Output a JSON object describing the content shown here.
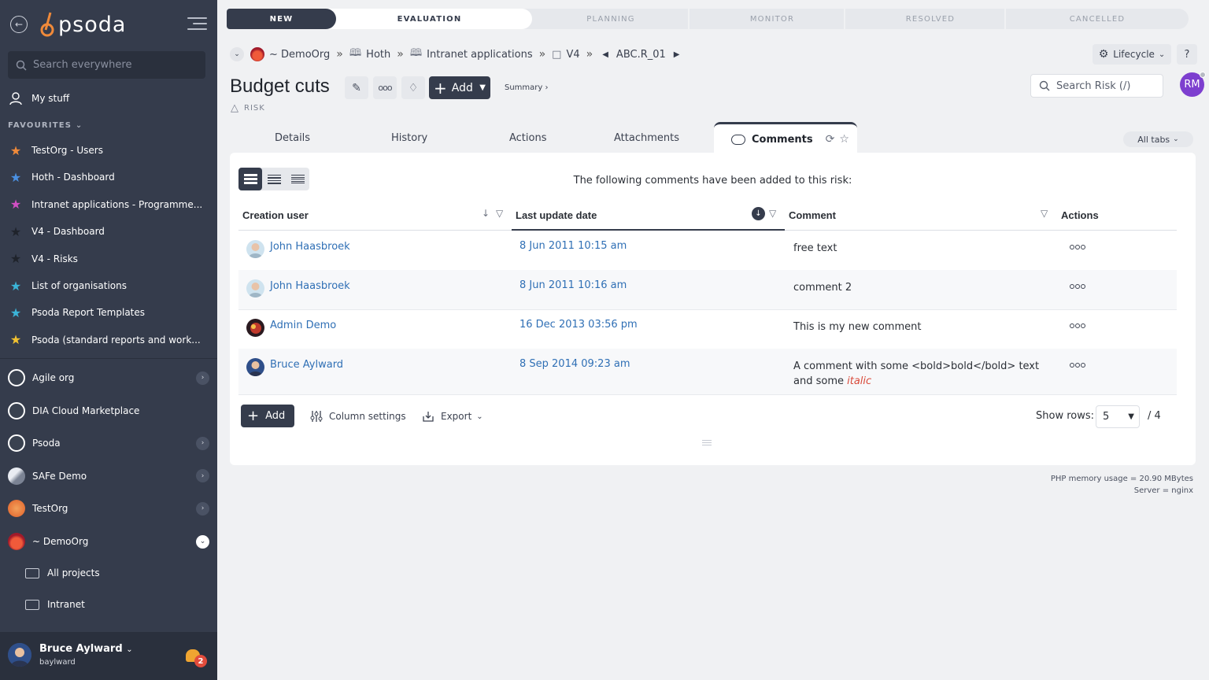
{
  "sidebar": {
    "search_placeholder": "Search everywhere",
    "my_stuff": "My stuff",
    "favourites_heading": "FAVOURITES",
    "favourites": [
      {
        "label": "TestOrg - Users",
        "color": "#f08a3a"
      },
      {
        "label": "Hoth - Dashboard",
        "color": "#4a90e2"
      },
      {
        "label": "Intranet applications - Programme...",
        "color": "#d24fc4"
      },
      {
        "label": "V4 - Dashboard",
        "color": "#1f232b"
      },
      {
        "label": "V4 - Risks",
        "color": "#1f232b"
      },
      {
        "label": "List of organisations",
        "color": "#3bb4d8"
      },
      {
        "label": "Psoda Report Templates",
        "color": "#3bb4d8"
      },
      {
        "label": "Psoda (standard reports and work...",
        "color": "#f2c230"
      }
    ],
    "orgs": [
      {
        "label": "Agile org",
        "has_chevron": true
      },
      {
        "label": "DIA Cloud Marketplace",
        "has_chevron": false
      },
      {
        "label": "Psoda",
        "has_chevron": true
      },
      {
        "label": "SAFe Demo",
        "has_chevron": true
      },
      {
        "label": "TestOrg",
        "has_chevron": true
      },
      {
        "label": "~ DemoOrg",
        "has_chevron": true,
        "open": true
      }
    ],
    "sub_items": [
      "All projects",
      "Intranet"
    ],
    "user": {
      "name": "Bruce Aylward",
      "username": "baylward",
      "notifications": "2"
    }
  },
  "lifecycle": [
    "NEW",
    "EVALUATION",
    "PLANNING",
    "MONITOR",
    "RESOLVED",
    "CANCELLED"
  ],
  "breadcrumb": {
    "org": "~ DemoOrg",
    "items": [
      "Hoth",
      "Intranet applications",
      "V4"
    ],
    "current": "ABC.R_01"
  },
  "header": {
    "title": "Budget cuts",
    "type_label": "RISK",
    "add_label": "Add",
    "summary_label": "Summary ›",
    "lifecycle_button": "Lifecycle",
    "help": "?",
    "search_placeholder": "Search Risk (/)",
    "user_initials": "RM"
  },
  "tabs": {
    "items": [
      "Details",
      "History",
      "Actions",
      "Attachments"
    ],
    "active": "Comments",
    "all_tabs": "All tabs"
  },
  "comments": {
    "intro": "The following comments have been added to this risk:",
    "columns": [
      "Creation user",
      "Last update date",
      "Comment",
      "Actions"
    ],
    "rows": [
      {
        "user": "John Haasbroek",
        "date": "8 Jun 2011 10:15 am",
        "comment": "free text",
        "avatar": "john"
      },
      {
        "user": "John Haasbroek",
        "date": "8 Jun 2011 10:16 am",
        "comment": "comment 2",
        "avatar": "john"
      },
      {
        "user": "Admin Demo",
        "date": "16 Dec 2013 03:56 pm",
        "comment": "This is my new comment",
        "avatar": "admin"
      },
      {
        "user": "Bruce Aylward",
        "date": "8 Sep 2014 09:23 am",
        "comment_prefix": "A comment with some <bold>bold</bold> text and some ",
        "comment_italic": "italic",
        "avatar": "bruce"
      }
    ],
    "footer": {
      "add_label": "Add",
      "column_settings": "Column settings",
      "export": "Export",
      "show_rows_label": "Show rows:",
      "show_rows_value": "5",
      "total": "/ 4"
    }
  },
  "server_info": {
    "memory": "PHP memory usage = 20.90 MBytes",
    "server": "Server = nginx"
  }
}
